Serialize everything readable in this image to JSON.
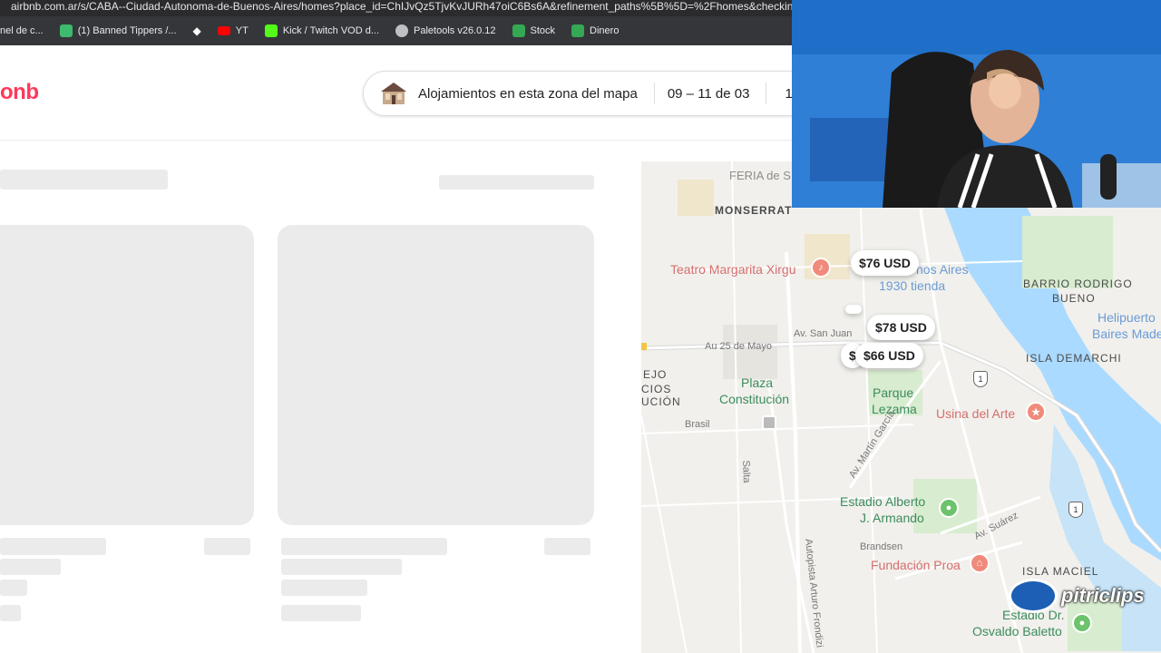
{
  "browser": {
    "url": "airbnb.com.ar/s/CABA--Ciudad-Autonoma-de-Buenos-Aires/homes?place_id=ChIJvQz5TjvKvJURh47oiC6Bs6A&refinement_paths%5B%5D=%2Fhomes&checkin=202",
    "bookmarks": [
      {
        "label": "nel de c...",
        "icon": "panel-icon",
        "color": "#8ab4f8"
      },
      {
        "label": "(1) Banned Tippers /...",
        "icon": "tipper-icon",
        "color": "#3dba6e"
      },
      {
        "label": "",
        "icon": "diamond-icon",
        "color": "#ffffff"
      },
      {
        "label": "YT",
        "icon": "youtube-icon",
        "color": "#ff0000"
      },
      {
        "label": "Kick / Twitch VOD d...",
        "icon": "kick-icon",
        "color": "#53fc18"
      },
      {
        "label": "Paletools v26.0.12",
        "icon": "globe-icon",
        "color": "#bdc1c6"
      },
      {
        "label": "Stock",
        "icon": "sheets-icon",
        "color": "#34a853"
      },
      {
        "label": "Dinero",
        "icon": "sheets-icon",
        "color": "#34a853"
      }
    ]
  },
  "header": {
    "logo": "onb",
    "search_location": "Alojamientos en esta zona del mapa",
    "search_dates": "09 – 11 de 03",
    "search_guests": "1"
  },
  "map": {
    "labels": {
      "feria": "FERIA de S",
      "monserrat": "MONSERRAT",
      "teatro": "Teatro Margarita Xirgu",
      "buenos_aires": "nos Aires",
      "tienda": "1930 tienda",
      "barrio": "BARRIO RODRIGO",
      "bueno": "BUENO",
      "helipuerto": "Helipuerto",
      "baires": "Baires Mader",
      "isla_demarchi": "ISLA DEMARCHI",
      "av_san_juan": "Av. San Juan",
      "au25": "Au 25 de Mayo",
      "plaza": "Plaza",
      "constitucion": "Constitución",
      "parque": "Parque",
      "lezama": "Lezama",
      "usina": "Usina del Arte",
      "ejo": "EJO",
      "cios": "CIOS",
      "ucion": "UCIÓN",
      "brasil": "Brasil",
      "salta": "Salta",
      "av_martin_garcia": "Av. Martín García",
      "estadio1": "Estadio Alberto",
      "estadio2": "J. Armando",
      "av_suarez": "Av. Suárez",
      "brandsen": "Brandsen",
      "fundacion": "Fundación Proa",
      "isla_maciel": "ISLA MACIEL",
      "autopista": "Autopista Arturo Frondizi",
      "estadio_dr": "Estadio Dr.",
      "baletto": "Osvaldo Baletto",
      "route1": "1",
      "route1b": "1"
    },
    "prices": [
      "$76 USD",
      "$78 USD",
      "$66 USD",
      "$"
    ]
  },
  "watermark": "pitriclips",
  "colors": {
    "airbnb": "#ff385c",
    "skeleton": "#ebebeb",
    "map_bg": "#f1f0ec",
    "water": "#aadaff"
  }
}
